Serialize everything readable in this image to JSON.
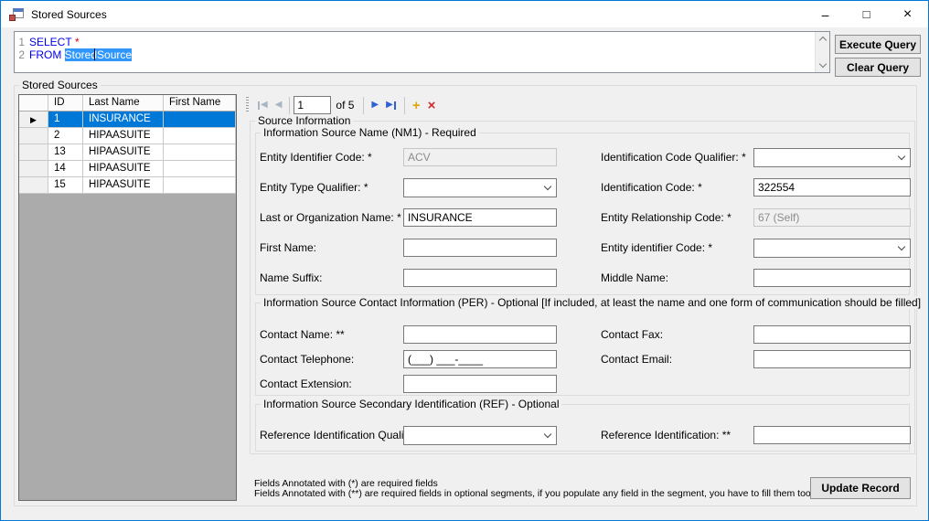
{
  "titlebar": {
    "title": "Stored Sources"
  },
  "icons": {
    "minimize": "–",
    "maximize": "□",
    "close": "×",
    "nav_prev": "◀",
    "nav_next": "▶",
    "add": "+",
    "delete": "×",
    "current_row": "▶"
  },
  "query": {
    "line1": {
      "num": "1",
      "keyword": "SELECT",
      "star": "*"
    },
    "line2": {
      "num": "2",
      "keyword": "FROM",
      "table": "StoredSource"
    }
  },
  "actions": {
    "execute": "Execute Query",
    "clear": "Clear Query",
    "update": "Update Record"
  },
  "grid_group": {
    "title": "Stored Sources"
  },
  "grid": {
    "columns": {
      "id": "ID",
      "last": "Last Name",
      "first": "First Name"
    },
    "rows": [
      {
        "id": "1",
        "last": "INSURANCE",
        "first": ""
      },
      {
        "id": "2",
        "last": "HIPAASUITE",
        "first": ""
      },
      {
        "id": "13",
        "last": "HIPAASUITE",
        "first": ""
      },
      {
        "id": "14",
        "last": "HIPAASUITE",
        "first": ""
      },
      {
        "id": "15",
        "last": "HIPAASUITE",
        "first": ""
      }
    ]
  },
  "navigator": {
    "position": "1",
    "count_label": "of 5"
  },
  "source_info": {
    "title": "Source Information",
    "nm1": {
      "title": "Information Source Name (NM1) - Required",
      "entity_identifier_code": {
        "label": "Entity Identifier Code: *",
        "value": "ACV"
      },
      "identification_code_qualifier": {
        "label": "Identification Code Qualifier: *",
        "value": ""
      },
      "entity_type_qualifier": {
        "label": "Entity Type Qualifier: *",
        "value": ""
      },
      "identification_code": {
        "label": "Identification Code: *",
        "value": "322554"
      },
      "last_or_organization_name": {
        "label": "Last or Organization Name: *",
        "value": "INSURANCE"
      },
      "entity_relationship_code": {
        "label": "Entity Relationship Code: *",
        "value": "67 (Self)"
      },
      "first_name": {
        "label": "First Name:",
        "value": ""
      },
      "entity_identifier_code_2": {
        "label": "Entity identifier Code: *",
        "value": ""
      },
      "name_suffix": {
        "label": "Name Suffix:",
        "value": ""
      },
      "middle_name": {
        "label": "Middle Name:",
        "value": ""
      }
    },
    "per": {
      "title": "Information Source Contact Information (PER) - Optional [If included, at least the name and one form of communication should be filled]",
      "contact_name": {
        "label": "Contact Name: **",
        "value": ""
      },
      "contact_fax": {
        "label": "Contact Fax:",
        "value": ""
      },
      "contact_telephone": {
        "label": "Contact Telephone:",
        "value": "(___) ___-____"
      },
      "contact_email": {
        "label": "Contact Email:",
        "value": ""
      },
      "contact_extension": {
        "label": "Contact Extension:",
        "value": ""
      }
    },
    "ref": {
      "title": "Information Source Secondary Identification (REF) - Optional",
      "reference_identification_qualifier": {
        "label": "Reference Identification Qualifier: **",
        "value": ""
      },
      "reference_identification": {
        "label": "Reference Identification: **",
        "value": ""
      }
    }
  },
  "footer": {
    "note1": "Fields Annotated with (*) are required fields",
    "note2": "Fields Annotated with (**) are required fields in optional segments, if you populate any field in the segment, you have to fill them too."
  }
}
